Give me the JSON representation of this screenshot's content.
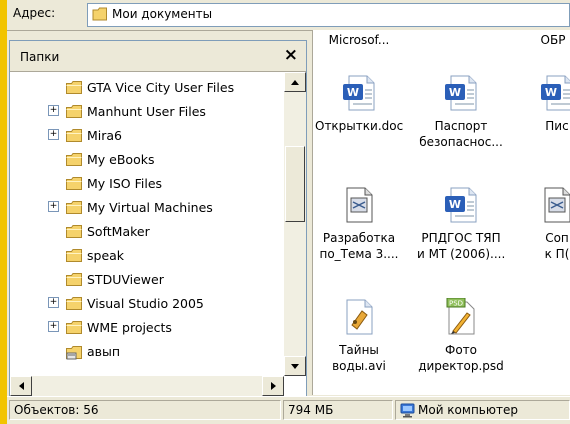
{
  "address": {
    "label": "Адрес:",
    "value": "Мои документы"
  },
  "folders": {
    "title": "Папки",
    "close": "×",
    "items": [
      {
        "label": "GTA Vice City User Files",
        "expandable": false
      },
      {
        "label": "Manhunt User Files",
        "expandable": true
      },
      {
        "label": "Mira6",
        "expandable": true
      },
      {
        "label": "My eBooks",
        "expandable": false
      },
      {
        "label": "My ISO Files",
        "expandable": false
      },
      {
        "label": "My Virtual Machines",
        "expandable": true
      },
      {
        "label": "SoftMaker",
        "expandable": false
      },
      {
        "label": "speak",
        "expandable": false
      },
      {
        "label": "STDUViewer",
        "expandable": false
      },
      {
        "label": "Visual Studio 2005",
        "expandable": true
      },
      {
        "label": "WME projects",
        "expandable": true
      },
      {
        "label": "авып",
        "expandable": false
      }
    ]
  },
  "files": {
    "top_row": [
      "Microsof...",
      "ОБР"
    ],
    "items": [
      {
        "label": "Открытки.doc",
        "icon": "word-doc-icon"
      },
      {
        "label": "Паспорт\nбезопаснос...",
        "icon": "word-doc-icon"
      },
      {
        "label": "Пис",
        "icon": "word-doc-icon"
      },
      {
        "label": "Разработка\nпо_Тема 3....",
        "icon": "document-icon"
      },
      {
        "label": "РПДГОС ТЯП\nи МТ (2006)....",
        "icon": "word-doc-icon"
      },
      {
        "label": "Соп\nк П(",
        "icon": "document-icon"
      },
      {
        "label": "Тайны\nводы.avi",
        "icon": "video-file-icon"
      },
      {
        "label": "Фото\nдиректор.psd",
        "icon": "psd-file-icon"
      }
    ]
  },
  "status": {
    "objects": "Объектов: 56",
    "size": "794 МБ",
    "location": "Мой компьютер"
  },
  "colors": {
    "folder": "#f5d26b",
    "word": "#2b5fb8",
    "frame": "#ece9d8",
    "accent": "#f2c400"
  }
}
